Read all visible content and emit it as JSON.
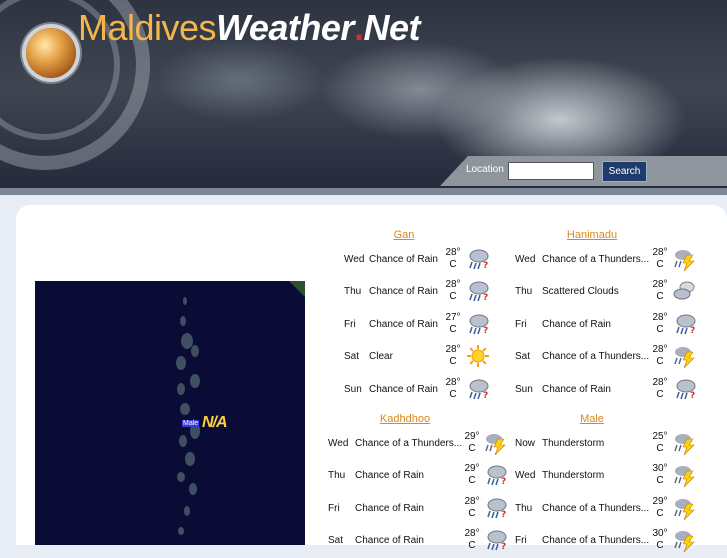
{
  "header": {
    "logo_part1": "Maldives",
    "logo_part2": "Weather",
    "logo_dot": ".",
    "logo_part3": "Net",
    "location_label": "Location",
    "location_value": "",
    "search_label": "Search"
  },
  "map": {
    "label": "Male",
    "value": "N/A"
  },
  "forecasts": [
    {
      "city": "Gan",
      "days": [
        {
          "day": "Wed",
          "condition": "Chance of Rain",
          "temp": "28°",
          "unit": "C",
          "icon": "rain-cloud-icon"
        },
        {
          "day": "Thu",
          "condition": "Chance of Rain",
          "temp": "28°",
          "unit": "C",
          "icon": "rain-cloud-icon"
        },
        {
          "day": "Fri",
          "condition": "Chance of Rain",
          "temp": "27°",
          "unit": "C",
          "icon": "rain-cloud-icon"
        },
        {
          "day": "Sat",
          "condition": "Clear",
          "temp": "28°",
          "unit": "C",
          "icon": "sun-icon"
        },
        {
          "day": "Sun",
          "condition": "Chance of Rain",
          "temp": "28°",
          "unit": "C",
          "icon": "rain-cloud-icon"
        }
      ]
    },
    {
      "city": "Hanimadu",
      "days": [
        {
          "day": "Wed",
          "condition": "Chance of a Thunders...",
          "temp": "28°",
          "unit": "C",
          "icon": "thunderstorm-icon"
        },
        {
          "day": "Thu",
          "condition": "Scattered Clouds",
          "temp": "28°",
          "unit": "C",
          "icon": "clouds-icon"
        },
        {
          "day": "Fri",
          "condition": "Chance of Rain",
          "temp": "28°",
          "unit": "C",
          "icon": "rain-cloud-icon"
        },
        {
          "day": "Sat",
          "condition": "Chance of a Thunders...",
          "temp": "28°",
          "unit": "C",
          "icon": "thunderstorm-icon"
        },
        {
          "day": "Sun",
          "condition": "Chance of Rain",
          "temp": "28°",
          "unit": "C",
          "icon": "rain-cloud-icon"
        }
      ]
    },
    {
      "city": "Kadhdhoo",
      "days": [
        {
          "day": "Wed",
          "condition": "Chance of a Thunders...",
          "temp": "29°",
          "unit": "C",
          "icon": "thunderstorm-icon"
        },
        {
          "day": "Thu",
          "condition": "Chance of Rain",
          "temp": "29°",
          "unit": "C",
          "icon": "rain-cloud-icon"
        },
        {
          "day": "Fri",
          "condition": "Chance of Rain",
          "temp": "28°",
          "unit": "C",
          "icon": "rain-cloud-icon"
        },
        {
          "day": "Sat",
          "condition": "Chance of Rain",
          "temp": "28°",
          "unit": "C",
          "icon": "rain-cloud-icon"
        }
      ]
    },
    {
      "city": "Male",
      "days": [
        {
          "day": "Now",
          "condition": "Thunderstorm",
          "temp": "25°",
          "unit": "C",
          "icon": "thunderstorm-icon"
        },
        {
          "day": "Wed",
          "condition": "Thunderstorm",
          "temp": "30°",
          "unit": "C",
          "icon": "thunderstorm-icon"
        },
        {
          "day": "Thu",
          "condition": "Chance of a Thunders...",
          "temp": "29°",
          "unit": "C",
          "icon": "thunderstorm-icon"
        },
        {
          "day": "Fri",
          "condition": "Chance of a Thunders...",
          "temp": "30°",
          "unit": "C",
          "icon": "thunderstorm-icon"
        }
      ]
    }
  ]
}
